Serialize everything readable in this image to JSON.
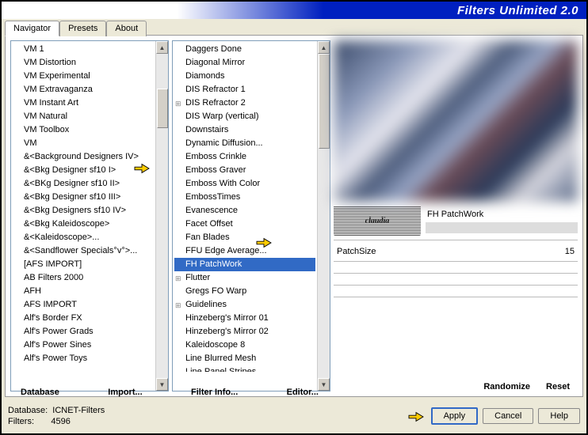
{
  "header": {
    "title": "Filters Unlimited 2.0"
  },
  "tabs": [
    "Navigator",
    "Presets",
    "About"
  ],
  "categories": [
    {
      "label": "VM 1"
    },
    {
      "label": "VM Distortion"
    },
    {
      "label": "VM Experimental"
    },
    {
      "label": "VM Extravaganza"
    },
    {
      "label": "VM Instant Art"
    },
    {
      "label": "VM Natural"
    },
    {
      "label": "VM Toolbox"
    },
    {
      "label": "VM"
    },
    {
      "label": "&<Background Designers IV>"
    },
    {
      "label": "&<Bkg Designer sf10 I>"
    },
    {
      "label": "&<BKg Designer sf10 II>",
      "highlighted": true
    },
    {
      "label": "&<Bkg Designer sf10 III>"
    },
    {
      "label": "&<Bkg Designers sf10 IV>"
    },
    {
      "label": "&<Bkg Kaleidoscope>"
    },
    {
      "label": "&<Kaleidoscope>..."
    },
    {
      "label": "&<Sandflower Specials°v°>..."
    },
    {
      "label": "[AFS IMPORT]"
    },
    {
      "label": "AB Filters 2000"
    },
    {
      "label": "AFH"
    },
    {
      "label": "AFS IMPORT"
    },
    {
      "label": "Alf's Border FX"
    },
    {
      "label": "Alf's Power Grads"
    },
    {
      "label": "Alf's Power Sines"
    },
    {
      "label": "Alf's Power Toys"
    }
  ],
  "filters": [
    {
      "label": "Daggers Done"
    },
    {
      "label": "Diagonal Mirror"
    },
    {
      "label": "Diamonds"
    },
    {
      "label": "DIS Refractor 1"
    },
    {
      "label": "DIS Refractor 2",
      "expand": true
    },
    {
      "label": "DIS Warp (vertical)"
    },
    {
      "label": "Downstairs"
    },
    {
      "label": "Dynamic Diffusion..."
    },
    {
      "label": "Emboss Crinkle"
    },
    {
      "label": "Emboss Graver"
    },
    {
      "label": "Emboss With Color"
    },
    {
      "label": "EmbossTimes"
    },
    {
      "label": "Evanescence"
    },
    {
      "label": "Facet Offset"
    },
    {
      "label": "Fan Blades"
    },
    {
      "label": "FFU Edge Average..."
    },
    {
      "label": "FH PatchWork",
      "selected": true
    },
    {
      "label": "Flutter",
      "expand": true
    },
    {
      "label": "Gregs FO Warp"
    },
    {
      "label": "Guidelines",
      "expand": true
    },
    {
      "label": "Hinzeberg's Mirror 01"
    },
    {
      "label": "Hinzeberg's Mirror 02"
    },
    {
      "label": "Kaleidoscope 8"
    },
    {
      "label": "Line Blurred Mesh"
    },
    {
      "label": "Line Panel Stripes"
    }
  ],
  "preview": {
    "watermark": "claudia",
    "filter_name": "FH PatchWork"
  },
  "params": [
    {
      "name": "PatchSize",
      "value": "15"
    }
  ],
  "buttons": {
    "database": "Database",
    "import": "Import...",
    "filter_info": "Filter Info...",
    "editor": "Editor...",
    "randomize": "Randomize",
    "reset": "Reset",
    "apply": "Apply",
    "cancel": "Cancel",
    "help": "Help"
  },
  "status": {
    "database_label": "Database:",
    "database_value": "ICNET-Filters",
    "filters_label": "Filters:",
    "filters_value": "4596"
  }
}
